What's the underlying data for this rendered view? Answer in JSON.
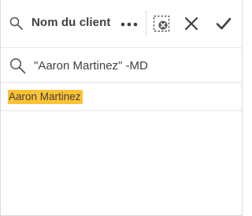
{
  "header": {
    "title": "Nom du client",
    "icons": {
      "search": "search-icon",
      "more": "more-horizontal-icon",
      "clear_selection": "clear-selection-icon",
      "cancel": "close-icon",
      "confirm": "checkmark-icon"
    }
  },
  "search": {
    "value": "\"Aaron Martinez\" -MD",
    "icon": "search-icon"
  },
  "results": {
    "items": [
      {
        "label": "Aaron Martinez",
        "state": "matched"
      }
    ]
  },
  "colors": {
    "highlight": "#ffc233",
    "text": "#404040",
    "divider": "#e6e6e6"
  }
}
